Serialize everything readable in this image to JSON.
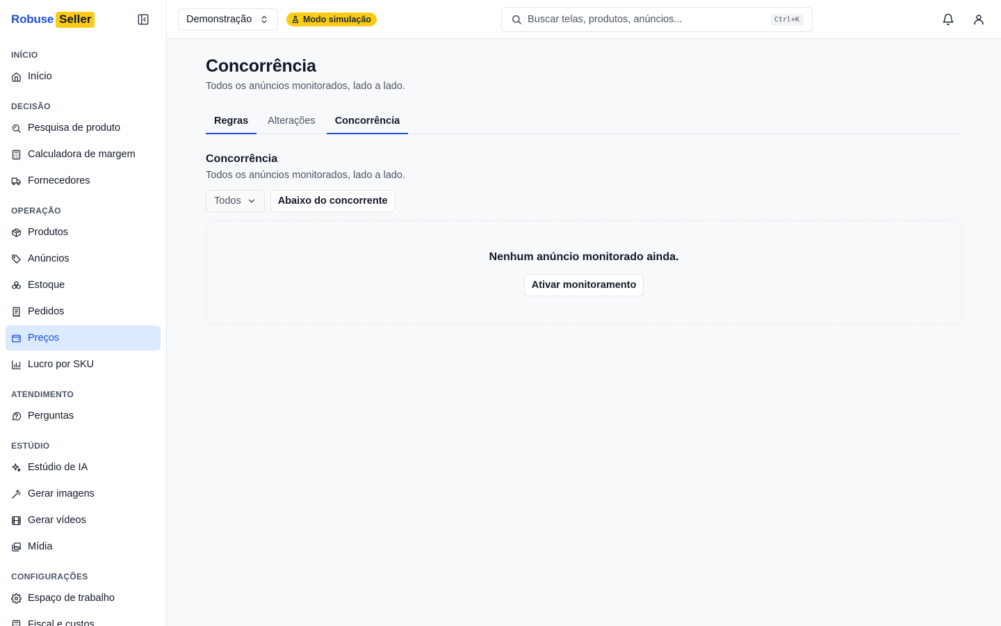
{
  "brand": {
    "word": "Robuse",
    "badge": "Seller"
  },
  "sidebar": {
    "sections": [
      {
        "label": "Início",
        "items": [
          {
            "label": "Início",
            "icon": "home-icon"
          }
        ]
      },
      {
        "label": "Decisão",
        "items": [
          {
            "label": "Pesquisa de produto",
            "icon": "search-product-icon"
          },
          {
            "label": "Calculadora de margem",
            "icon": "calculator-icon"
          },
          {
            "label": "Fornecedores",
            "icon": "truck-icon"
          }
        ]
      },
      {
        "label": "Operação",
        "items": [
          {
            "label": "Produtos",
            "icon": "package-icon"
          },
          {
            "label": "Anúncios",
            "icon": "tag-icon"
          },
          {
            "label": "Estoque",
            "icon": "boxes-icon"
          },
          {
            "label": "Pedidos",
            "icon": "receipt-icon"
          },
          {
            "label": "Preços",
            "icon": "wallet-icon",
            "active": true
          },
          {
            "label": "Lucro por SKU",
            "icon": "bar-chart-icon"
          }
        ]
      },
      {
        "label": "Atendimento",
        "items": [
          {
            "label": "Perguntas",
            "icon": "help-bubble-icon"
          }
        ]
      },
      {
        "label": "Estúdio",
        "items": [
          {
            "label": "Estúdio de IA",
            "icon": "sparkles-icon"
          },
          {
            "label": "Gerar imagens",
            "icon": "magic-wand-icon"
          },
          {
            "label": "Gerar vídeos",
            "icon": "film-icon"
          },
          {
            "label": "Mídia",
            "icon": "images-icon"
          }
        ]
      },
      {
        "label": "Configurações",
        "items": [
          {
            "label": "Espaço de trabalho",
            "icon": "gear-icon"
          },
          {
            "label": "Fiscal e custos",
            "icon": "calculator-icon"
          }
        ]
      }
    ]
  },
  "topbar": {
    "workspace": "Demonstração",
    "sim_badge": "Modo simulação",
    "search_placeholder": "Buscar telas, produtos, anúncios...",
    "shortcut": "Ctrl+K"
  },
  "main": {
    "title": "Concorrência",
    "subtitle": "Todos os anúncios monitorados, lado a lado.",
    "tabs": [
      {
        "label": "Regras"
      },
      {
        "label": "Alterações"
      },
      {
        "label": "Concorrência",
        "active": true
      }
    ],
    "section_title": "Concorrência",
    "section_subtitle": "Todos os anúncios monitorados, lado a lado.",
    "filter_select": "Todos",
    "filter_button": "Abaixo do concorrente",
    "empty_title": "Nenhum anúncio monitorado ainda.",
    "empty_button": "Ativar monitoramento"
  },
  "colors": {
    "accent": "#1d4ed8",
    "badge": "#facc15",
    "active_bg": "#dbeafe"
  }
}
